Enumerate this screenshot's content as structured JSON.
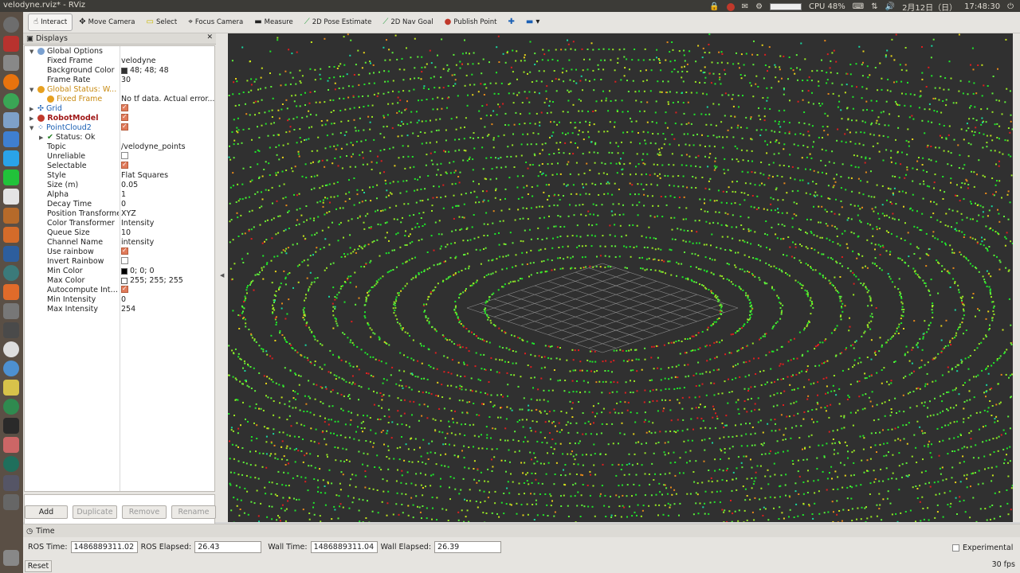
{
  "window": {
    "title": "velodyne.rviz* - RViz"
  },
  "systray": {
    "cpu": "CPU 48%",
    "date": "2月12日（日）",
    "time": "17:48:30"
  },
  "toolbar": {
    "tools": [
      "Interact",
      "Move Camera",
      "Select",
      "Focus Camera",
      "Measure",
      "2D Pose Estimate",
      "2D Nav Goal",
      "Publish Point"
    ]
  },
  "displays": {
    "header": "Displays",
    "rows": [
      {
        "name": "Global Options",
        "value": ""
      },
      {
        "name": "Fixed Frame",
        "value": "velodyne"
      },
      {
        "name": "Background Color",
        "value": "48; 48; 48"
      },
      {
        "name": "Frame Rate",
        "value": "30"
      },
      {
        "name": "Global Status: W...",
        "value": ""
      },
      {
        "name": "Fixed Frame",
        "value": "No tf data.  Actual error..."
      },
      {
        "name": "Grid",
        "value": ""
      },
      {
        "name": "RobotModel",
        "value": ""
      },
      {
        "name": "PointCloud2",
        "value": ""
      },
      {
        "name": "Status: Ok",
        "value": ""
      },
      {
        "name": "Topic",
        "value": "/velodyne_points"
      },
      {
        "name": "Unreliable",
        "value": ""
      },
      {
        "name": "Selectable",
        "value": ""
      },
      {
        "name": "Style",
        "value": "Flat Squares"
      },
      {
        "name": "Size (m)",
        "value": "0.05"
      },
      {
        "name": "Alpha",
        "value": "1"
      },
      {
        "name": "Decay Time",
        "value": "0"
      },
      {
        "name": "Position Transformer",
        "value": "XYZ"
      },
      {
        "name": "Color Transformer",
        "value": "Intensity"
      },
      {
        "name": "Queue Size",
        "value": "10"
      },
      {
        "name": "Channel Name",
        "value": "intensity"
      },
      {
        "name": "Use rainbow",
        "value": ""
      },
      {
        "name": "Invert Rainbow",
        "value": ""
      },
      {
        "name": "Min Color",
        "value": "0; 0; 0"
      },
      {
        "name": "Max Color",
        "value": "255; 255; 255"
      },
      {
        "name": "Autocompute Intensity Bounds",
        "value": ""
      },
      {
        "name": "Min Intensity",
        "value": "0"
      },
      {
        "name": "Max Intensity",
        "value": "254"
      }
    ],
    "buttons": {
      "add": "Add",
      "duplicate": "Duplicate",
      "remove": "Remove",
      "rename": "Rename"
    }
  },
  "time": {
    "header": "Time",
    "ros_time_label": "ROS Time:",
    "ros_time": "1486889311.02",
    "ros_elapsed_label": "ROS Elapsed:",
    "ros_elapsed": "26.43",
    "wall_time_label": "Wall Time:",
    "wall_time": "1486889311.04",
    "wall_elapsed_label": "Wall Elapsed:",
    "wall_elapsed": "26.39",
    "experimental": "Experimental",
    "reset": "Reset",
    "fps": "30 fps"
  },
  "colors": {
    "background": "#303030",
    "accent": "#e07a5a",
    "status_warn": "#c88a10",
    "robotmodel": "#a01818",
    "pointcloud": "#1a5fb4"
  }
}
